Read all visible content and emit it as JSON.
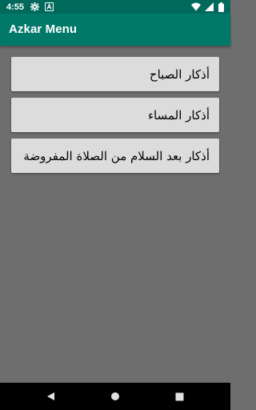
{
  "status_bar": {
    "time": "4:55",
    "icons": [
      "settings-gear-icon",
      "notification-a-icon",
      "wifi-icon",
      "cellular-signal-icon",
      "battery-icon"
    ]
  },
  "app_bar": {
    "title": "Azkar Menu",
    "background_color": "#00796b",
    "status_bar_color": "#00695c"
  },
  "menu": {
    "items": [
      {
        "label": "أذكار الصباح"
      },
      {
        "label": "أذكار المساء"
      },
      {
        "label": "أذكار بعد السلام من الصلاة المفروضة"
      }
    ],
    "button_color": "#dcdcdc"
  },
  "screen": {
    "background_color": "#6e6e6e"
  },
  "nav_bar": {
    "buttons": [
      "back-icon",
      "home-icon",
      "recents-icon"
    ]
  }
}
